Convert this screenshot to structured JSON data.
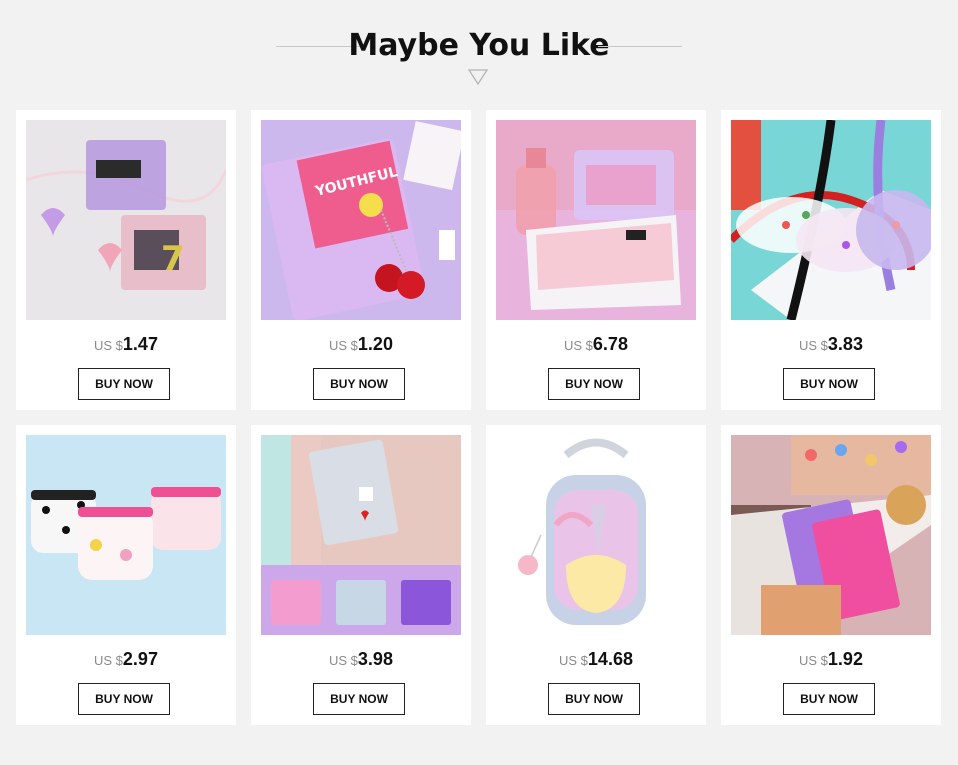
{
  "section": {
    "title": "Maybe You Like"
  },
  "products": [
    {
      "currency": "US $",
      "price": "1.47",
      "button": "BUY NOW",
      "image": "purple-glitter-card-holders"
    },
    {
      "currency": "US $",
      "price": "1.20",
      "button": "BUY NOW",
      "image": "youthful-days-card-sleeve"
    },
    {
      "currency": "US $",
      "price": "6.78",
      "button": "BUY NOW",
      "image": "clear-cosmetic-bag"
    },
    {
      "currency": "US $",
      "price": "3.83",
      "button": "BUY NOW",
      "image": "printed-waist-bags"
    },
    {
      "currency": "US $",
      "price": "2.97",
      "button": "BUY NOW",
      "image": "printed-coin-pouches"
    },
    {
      "currency": "US $",
      "price": "3.98",
      "button": "BUY NOW",
      "image": "holographic-card-wallets"
    },
    {
      "currency": "US $",
      "price": "14.68",
      "button": "BUY NOW",
      "image": "unicorn-mini-backpack"
    },
    {
      "currency": "US $",
      "price": "1.92",
      "button": "BUY NOW",
      "image": "glitter-passport-covers"
    }
  ]
}
